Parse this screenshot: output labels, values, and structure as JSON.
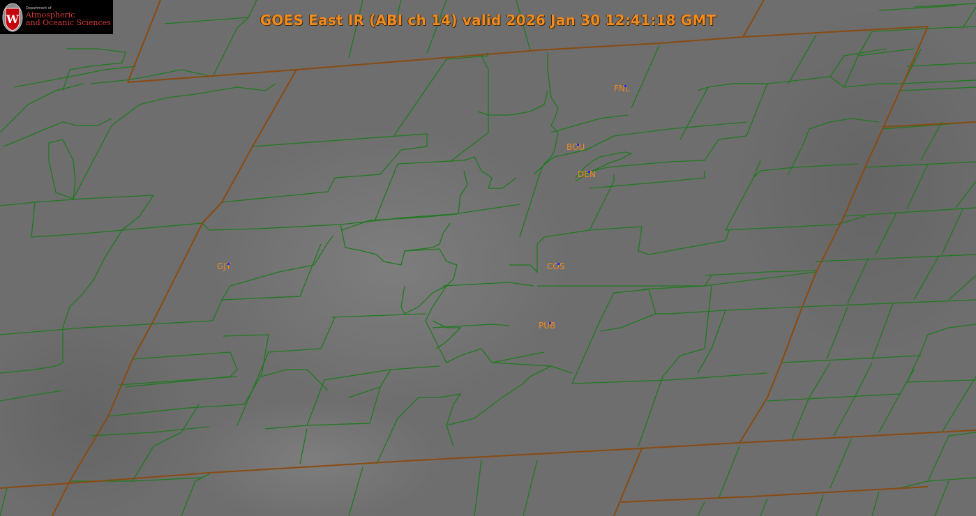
{
  "title": "GOES East IR (ABI ch 14) valid 2026 Jan 30 12:41:18 GMT",
  "logo": {
    "department": "Department of",
    "line1": "Atmospheric",
    "line2": "and Oceanic Sciences",
    "seal_letter": "W"
  },
  "stations": [
    {
      "id": "FNL",
      "label": "FNL"
    },
    {
      "id": "BOU",
      "label": "BOU"
    },
    {
      "id": "DEN",
      "label": "DEN"
    },
    {
      "id": "GJT",
      "label": "GJT"
    },
    {
      "id": "COS",
      "label": "COS"
    },
    {
      "id": "PUB",
      "label": "PUB"
    }
  ],
  "colors": {
    "county_lines": "#1f7a1f",
    "state_lines": "#8a4a10",
    "station_labels": "#f28a1e",
    "station_markers": "#1a2bff",
    "background": "#6f6f6f"
  }
}
